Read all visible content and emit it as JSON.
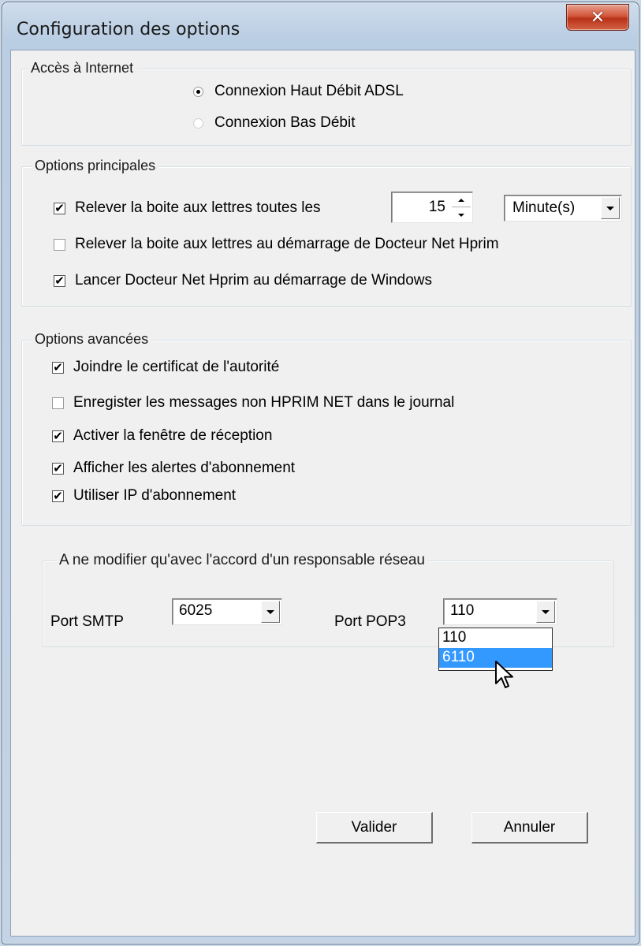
{
  "window": {
    "title": "Configuration des options",
    "close_glyph": "✕"
  },
  "internet": {
    "legend": "Accès à Internet",
    "options": [
      {
        "label": "Connexion Haut Débit ADSL",
        "selected": true
      },
      {
        "label": "Connexion Bas Débit",
        "selected": false
      }
    ]
  },
  "main_options": {
    "legend": "Options principales",
    "check_mail": {
      "label": "Relever la boite aux lettres toutes les",
      "checked": true
    },
    "interval_value": "15",
    "interval_unit": "Minute(s)",
    "check_at_startup": {
      "label": "Relever la boite aux lettres au démarrage de Docteur Net Hprim",
      "checked": false
    },
    "launch_with_windows": {
      "label": "Lancer Docteur Net Hprim au démarrage de Windows",
      "checked": true
    }
  },
  "advanced": {
    "legend": "Options avancées",
    "items": [
      {
        "label": "Joindre le certificat de l'autorité",
        "checked": true
      },
      {
        "label": "Enregister les messages non HPRIM NET dans le journal",
        "checked": false
      },
      {
        "label": "Activer la fenêtre de réception",
        "checked": true
      },
      {
        "label": "Afficher les alertes d'abonnement",
        "checked": true
      },
      {
        "label": "Utiliser IP d'abonnement",
        "checked": true
      }
    ]
  },
  "network": {
    "legend": "A ne modifier qu'avec l'accord d'un responsable réseau",
    "smtp_label": "Port SMTP",
    "smtp_value": "6025",
    "pop3_label": "Port POP3",
    "pop3_value": "110",
    "pop3_options": [
      "110",
      "6110"
    ],
    "pop3_highlighted": "6110"
  },
  "buttons": {
    "validate": "Valider",
    "cancel": "Annuler"
  },
  "icons": {
    "check_glyph": "✔",
    "cursor": "arrow-cursor-icon"
  },
  "colors": {
    "selection": "#3399ff",
    "close_button": "#c8452a",
    "dialog_bg": "#f0f0f0"
  }
}
